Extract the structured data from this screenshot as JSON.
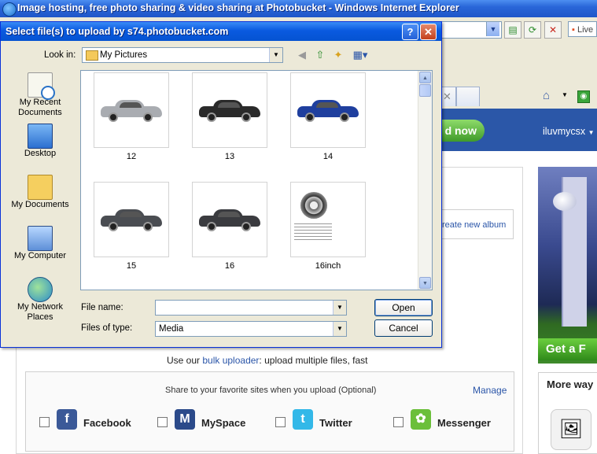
{
  "browser": {
    "title": "Image hosting, free photo sharing & video sharing at Photobucket - Windows Internet Explorer",
    "search_placeholder": "Live"
  },
  "page": {
    "download_label": "d now",
    "username": "iluvmycsx",
    "create_album_link": "reate new album",
    "bulk_prefix": "Use our ",
    "bulk_link": "bulk uploader",
    "bulk_suffix": ": upload multiple files, fast",
    "share_text": "Share to your favorite sites when you upload (Optional)",
    "manage_link": "Manage",
    "share_sites": [
      {
        "name": "Facebook",
        "icon": "f",
        "color": "#3b5998"
      },
      {
        "name": "MySpace",
        "icon": "M",
        "color": "#2b4a8a"
      },
      {
        "name": "Twitter",
        "icon": "t",
        "color": "#33b8e8"
      },
      {
        "name": "Messenger",
        "icon": "✿",
        "color": "#6bbf3a"
      }
    ],
    "ad_cta": "Get a F",
    "more_ways_title": "More way"
  },
  "dialog": {
    "title": "Select file(s) to upload by s74.photobucket.com",
    "help_label": "?",
    "close_label": "✕",
    "look_in_label": "Look in:",
    "look_in_value": "My Pictures",
    "places": [
      {
        "label": "My Recent Documents",
        "icon": "recent-documents-icon"
      },
      {
        "label": "Desktop",
        "icon": "desktop-icon"
      },
      {
        "label": "My Documents",
        "icon": "my-documents-icon"
      },
      {
        "label": "My Computer",
        "icon": "my-computer-icon"
      },
      {
        "label": "My Network Places",
        "icon": "network-places-icon"
      }
    ],
    "files": [
      {
        "name": "12",
        "car_color": "#a9acb1"
      },
      {
        "name": "13",
        "car_color": "#2a2a2a"
      },
      {
        "name": "14",
        "car_color": "#1f3f9e"
      },
      {
        "name": "15",
        "car_color": "#4a4d52"
      },
      {
        "name": "16",
        "car_color": "#3a3b3f"
      },
      {
        "name": "16inch",
        "car_color": ""
      }
    ],
    "file_name_label": "File name:",
    "file_name_value": "",
    "files_of_type_label": "Files of type:",
    "files_of_type_value": "Media",
    "open_label": "Open",
    "cancel_label": "Cancel"
  }
}
